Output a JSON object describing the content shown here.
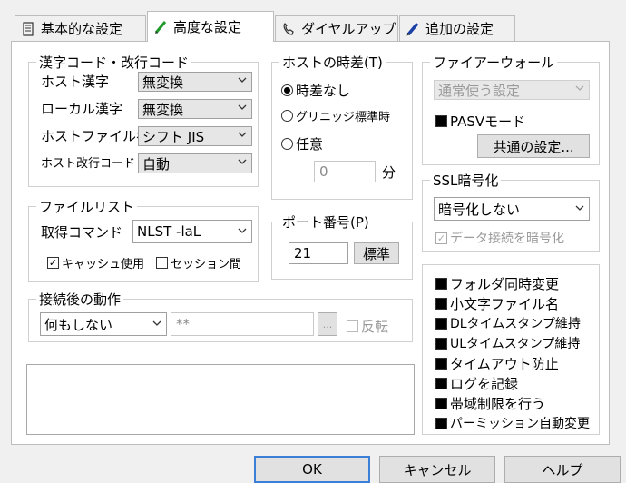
{
  "tabs": [
    {
      "label": "基本的な設定",
      "icon": "book-icon"
    },
    {
      "label": "高度な設定",
      "icon": "pen-icon"
    },
    {
      "label": "ダイヤルアップ",
      "icon": "phone-icon"
    },
    {
      "label": "追加の設定",
      "icon": "pencil-icon"
    }
  ],
  "kanji": {
    "title": "漢字コード・改行コード",
    "host_kanji_label": "ホスト漢字",
    "host_kanji_value": "無変換",
    "local_kanji_label": "ローカル漢字",
    "local_kanji_value": "無変換",
    "host_file_label": "ホストファイル名",
    "host_file_value": "シフト JIS",
    "host_newline_label": "ホスト改行コード",
    "host_newline_value": "自動"
  },
  "timezone": {
    "title": "ホストの時差(T)",
    "options": [
      "時差なし",
      "グリニッジ標準時",
      "任意"
    ],
    "selected": "時差なし",
    "offset_value": "0",
    "unit": "分"
  },
  "firewall": {
    "title": "ファイアーウォール",
    "mode_value": "通常使う設定",
    "pasv_label": "PASVモード",
    "common_button": "共通の設定..."
  },
  "filelist": {
    "title": "ファイルリスト",
    "command_label": "取得コマンド",
    "command_value": "NLST -laL",
    "cache_label": "キャッシュ使用",
    "session_label": "セッション間"
  },
  "port": {
    "title": "ポート番号(P)",
    "value": "21",
    "default_button": "標準"
  },
  "ssl": {
    "title": "SSL暗号化",
    "mode_value": "暗号化しない",
    "data_encrypt_label": "データ接続を暗号化"
  },
  "after_connect": {
    "title": "接続後の動作",
    "action_value": "何もしない",
    "target_value": "**",
    "browse_label": "...",
    "invert_label": "反転"
  },
  "options": [
    "フォルダ同時変更",
    "小文字ファイル名",
    "DLタイムスタンプ維持",
    "ULタイムスタンプ維持",
    "タイムアウト防止",
    "ログを記録",
    "帯域制限を行う",
    "パーミッション自動変更"
  ],
  "buttons": {
    "ok": "OK",
    "cancel": "キャンセル",
    "help": "ヘルプ"
  }
}
